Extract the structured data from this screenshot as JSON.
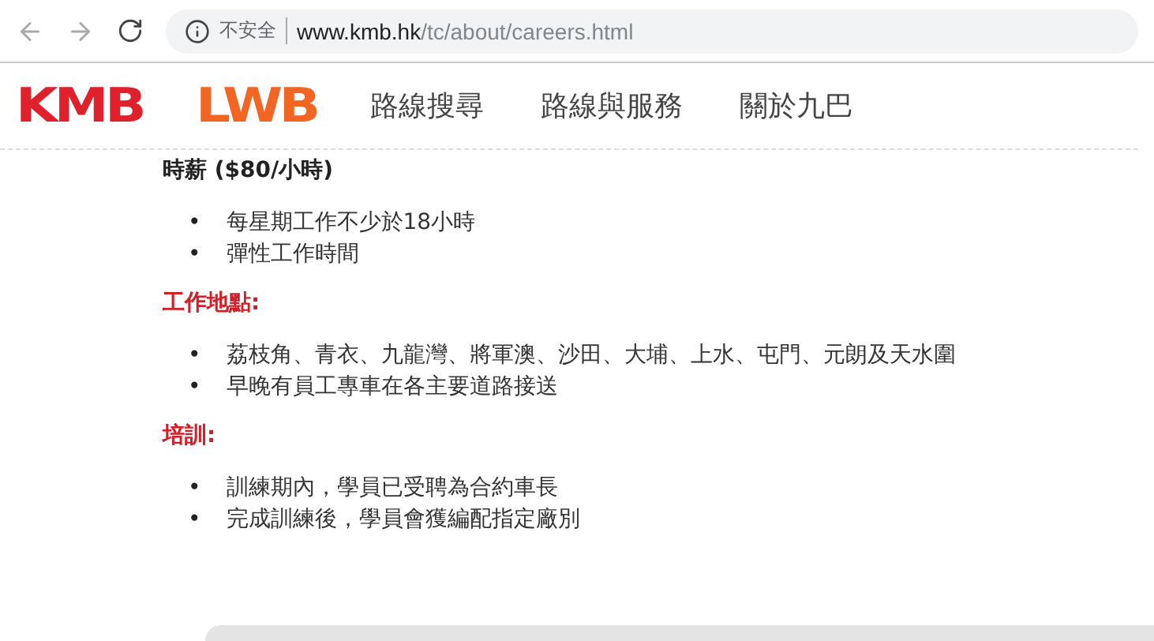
{
  "browser": {
    "security_label": "不安全",
    "url_host": "www.kmb.hk",
    "url_path": "/tc/about/careers.html"
  },
  "header": {
    "logos": [
      {
        "text": "KMB",
        "color": "#e0202a"
      },
      {
        "text": "LWB",
        "color": "#f26522"
      }
    ],
    "nav": [
      "路線搜尋",
      "路線與服務",
      "關於九巴"
    ]
  },
  "sections": [
    {
      "heading": "時薪 ($80/小時)",
      "kind": "plain",
      "bullet": "•",
      "items": [
        "每星期工作不少於18小時",
        "彈性工作時間"
      ]
    },
    {
      "heading": "工作地點:",
      "kind": "accent",
      "bullet": "•",
      "items": [
        "荔枝角、青衣、九龍灣、將軍澳、沙田、大埔、上水、屯門、元朗及天水圍",
        "早晚有員工專車在各主要道路接送"
      ]
    },
    {
      "heading": "培訓:",
      "kind": "accent",
      "bullet": "•",
      "items": [
        "訓練期內，學員已受聘為合約車長",
        "完成訓練後，學員會獲編配指定廠別"
      ]
    }
  ]
}
